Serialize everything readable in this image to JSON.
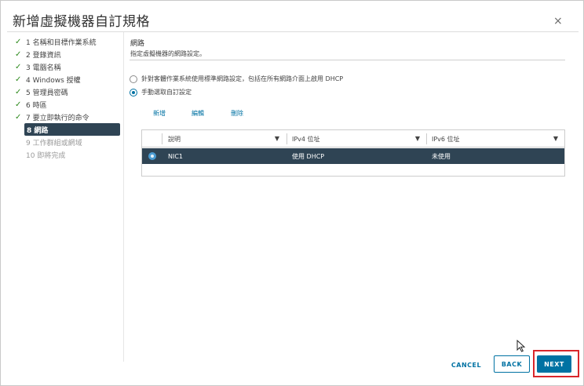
{
  "dialog": {
    "title": "新增虛擬機器自訂規格",
    "close_glyph": "×"
  },
  "steps": [
    {
      "label": "1 名稱和目標作業系統",
      "status": "done"
    },
    {
      "label": "2 登錄資訊",
      "status": "done"
    },
    {
      "label": "3 電腦名稱",
      "status": "done"
    },
    {
      "label": "4 Windows 授權",
      "status": "done"
    },
    {
      "label": "5 管理員密碼",
      "status": "done"
    },
    {
      "label": "6 時區",
      "status": "done"
    },
    {
      "label": "7 要立即執行的命令",
      "status": "done"
    },
    {
      "label": "8 網路",
      "status": "active"
    },
    {
      "label": "9 工作群組或網域",
      "status": "future"
    },
    {
      "label": "10 即將完成",
      "status": "future"
    }
  ],
  "check_glyph": "✓",
  "section": {
    "title": "網路",
    "subtitle": "指定虛擬機器的網路設定。"
  },
  "options": {
    "standard": "針對客體作業系統使用標準網路設定，包括在所有網路介面上啟用 DHCP",
    "manual": "手動選取自訂設定",
    "selected": "manual"
  },
  "actions": {
    "add": "新增",
    "edit": "編輯",
    "delete": "刪除"
  },
  "grid": {
    "columns": [
      "說明",
      "IPv4 位址",
      "IPv6 位址"
    ],
    "filter_glyph": "▼",
    "rows": [
      {
        "description": "NIC1",
        "ipv4": "使用 DHCP",
        "ipv6": "未使用",
        "selected": true
      }
    ]
  },
  "footer": {
    "cancel": "CANCEL",
    "back": "BACK",
    "next": "NEXT"
  },
  "colors": {
    "accent": "#0072a3",
    "selected_row": "#2f4454",
    "check": "#2e8a1d",
    "highlight_frame": "#d9262b"
  }
}
